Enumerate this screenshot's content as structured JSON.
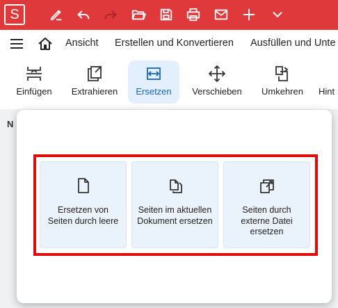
{
  "app": {
    "logo_letter": "S",
    "accent_color": "#e0393b",
    "toolbar_icons": [
      "pen-icon",
      "undo-icon",
      "redo-icon",
      "open-folder-icon",
      "save-icon",
      "print-icon",
      "mail-icon",
      "plus-icon",
      "chevron-down-icon"
    ]
  },
  "menu": {
    "items": [
      "Ansicht",
      "Erstellen und Konvertieren",
      "Ausfüllen und Unte"
    ]
  },
  "ribbon": {
    "buttons": [
      {
        "label": "Einfügen",
        "icon": "insert-icon"
      },
      {
        "label": "Extrahieren",
        "icon": "extract-icon"
      },
      {
        "label": "Ersetzen",
        "icon": "replace-icon",
        "active": true
      },
      {
        "label": "Verschieben",
        "icon": "move-icon"
      },
      {
        "label": "Umkehren",
        "icon": "reverse-icon"
      },
      {
        "label": "Hint",
        "icon": "background-icon"
      }
    ]
  },
  "background": {
    "cut_label": "N"
  },
  "popup": {
    "options": [
      {
        "label": "Ersetzen von Seiten durch leere",
        "icon": "blank-page-icon"
      },
      {
        "label": "Seiten im aktuellen Dokument ersetzen",
        "icon": "copy-pages-icon"
      },
      {
        "label": "Seiten durch externe Datei ersetzen",
        "icon": "external-file-icon"
      }
    ]
  }
}
